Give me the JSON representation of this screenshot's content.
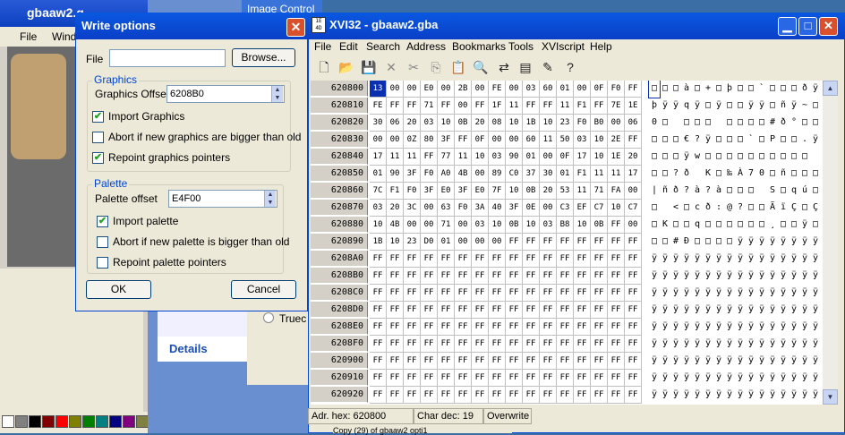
{
  "bg_app": {
    "title": "gbaaw2.g",
    "menu": [
      "File",
      "Windo"
    ]
  },
  "image_control": {
    "title": "Image Control",
    "details_tab": "Details",
    "truec_label": "Truec"
  },
  "dialog": {
    "title": "Write options",
    "file_label": "File",
    "file_value": "",
    "browse_button": "Browse...",
    "graphics_group": "Graphics",
    "graphics_offset_label": "Graphics Offset",
    "graphics_offset_value": "6208B0",
    "import_graphics": {
      "label": "Import Graphics",
      "checked": true
    },
    "abort_graphics": {
      "label": "Abort if new graphics are bigger than old",
      "checked": false
    },
    "repoint_graphics": {
      "label": "Repoint graphics pointers",
      "checked": true
    },
    "palette_group": "Palette",
    "palette_offset_label": "Palette offset",
    "palette_offset_value": "E4F00",
    "import_palette": {
      "label": "Import palette",
      "checked": true
    },
    "abort_palette": {
      "label": "Abort if new palette is bigger than old",
      "checked": false
    },
    "repoint_palette": {
      "label": "Repoint palette pointers",
      "checked": false
    },
    "ok_button": "OK",
    "cancel_button": "Cancel"
  },
  "xvi": {
    "title": "XVI32 - gbaaw2.gba",
    "menu": [
      "File",
      "Edit",
      "Search",
      "Address",
      "Bookmarks",
      "Tools",
      "XVIscript",
      "Help"
    ],
    "toolbar_icons": [
      "new-icon",
      "open-icon",
      "save-icon",
      "delete-icon",
      "cut-icon",
      "copy-icon",
      "paste-icon",
      "find-icon",
      "replace-icon",
      "properties-icon",
      "edit-icon",
      "help-icon"
    ],
    "rows": [
      {
        "addr": "620800",
        "hex": [
          "13",
          "00",
          "00",
          "E0",
          "00",
          "2B",
          "00",
          "FE",
          "00",
          "03",
          "60",
          "01",
          "00",
          "0F",
          "F0",
          "FF"
        ],
        "ascii": "□□□à□+□þ□□`□□□ðÿ"
      },
      {
        "addr": "620810",
        "hex": [
          "FE",
          "FF",
          "FF",
          "71",
          "FF",
          "00",
          "FF",
          "1F",
          "11",
          "FF",
          "FF",
          "11",
          "F1",
          "FF",
          "7E",
          "1E"
        ],
        "ascii": "þÿÿqÿ□ÿ□□ÿÿ□ñÿ~□"
      },
      {
        "addr": "620820",
        "hex": [
          "30",
          "06",
          "20",
          "03",
          "10",
          "0B",
          "20",
          "08",
          "10",
          "1B",
          "10",
          "23",
          "F0",
          "B0",
          "00",
          "06"
        ],
        "ascii": "0□ □□□ □□□□#ð°□□"
      },
      {
        "addr": "620830",
        "hex": [
          "00",
          "00",
          "0Z",
          "80",
          "3F",
          "FF",
          "0F",
          "00",
          "00",
          "60",
          "11",
          "50",
          "03",
          "10",
          "2E",
          "FF"
        ],
        "ascii": "□□□€?ÿ□□□`□P□□.ÿ"
      },
      {
        "addr": "620840",
        "hex": [
          "17",
          "11",
          "11",
          "FF",
          "77",
          "11",
          "10",
          "03",
          "90",
          "01",
          "00",
          "0F",
          "17",
          "10",
          "1E",
          "20"
        ],
        "ascii": "□□□ÿw□□□□□□□□□□ "
      },
      {
        "addr": "620850",
        "hex": [
          "01",
          "90",
          "3F",
          "F0",
          "A0",
          "4B",
          "00",
          "89",
          "C0",
          "37",
          "30",
          "01",
          "F1",
          "11",
          "11",
          "17"
        ],
        "ascii": "□□?ð K□‰À70□ñ□□□"
      },
      {
        "addr": "620860",
        "hex": [
          "7C",
          "F1",
          "F0",
          "3F",
          "E0",
          "3F",
          "E0",
          "7F",
          "10",
          "0B",
          "20",
          "53",
          "11",
          "71",
          "FA",
          "00"
        ],
        "ascii": "|ñð?à?à□□□ S□qú□"
      },
      {
        "addr": "620870",
        "hex": [
          "03",
          "20",
          "3C",
          "00",
          "63",
          "F0",
          "3A",
          "40",
          "3F",
          "0E",
          "00",
          "C3",
          "EF",
          "C7",
          "10",
          "C7"
        ],
        "ascii": "□ <□cð:@?□□ÃïÇ□Ç"
      },
      {
        "addr": "620880",
        "hex": [
          "10",
          "4B",
          "00",
          "00",
          "71",
          "00",
          "03",
          "10",
          "0B",
          "10",
          "03",
          "B8",
          "10",
          "0B",
          "FF",
          "00"
        ],
        "ascii": "□K□□q□□□□□□¸□□ÿ□"
      },
      {
        "addr": "620890",
        "hex": [
          "1B",
          "10",
          "23",
          "D0",
          "01",
          "00",
          "00",
          "00",
          "FF",
          "FF",
          "FF",
          "FF",
          "FF",
          "FF",
          "FF",
          "FF"
        ],
        "ascii": "□□#Ð□□□□ÿÿÿÿÿÿÿÿ"
      },
      {
        "addr": "6208A0",
        "hex": [
          "FF",
          "FF",
          "FF",
          "FF",
          "FF",
          "FF",
          "FF",
          "FF",
          "FF",
          "FF",
          "FF",
          "FF",
          "FF",
          "FF",
          "FF",
          "FF"
        ],
        "ascii": "ÿÿÿÿÿÿÿÿÿÿÿÿÿÿÿÿ"
      },
      {
        "addr": "6208B0",
        "hex": [
          "FF",
          "FF",
          "FF",
          "FF",
          "FF",
          "FF",
          "FF",
          "FF",
          "FF",
          "FF",
          "FF",
          "FF",
          "FF",
          "FF",
          "FF",
          "FF"
        ],
        "ascii": "ÿÿÿÿÿÿÿÿÿÿÿÿÿÿÿÿ"
      },
      {
        "addr": "6208C0",
        "hex": [
          "FF",
          "FF",
          "FF",
          "FF",
          "FF",
          "FF",
          "FF",
          "FF",
          "FF",
          "FF",
          "FF",
          "FF",
          "FF",
          "FF",
          "FF",
          "FF"
        ],
        "ascii": "ÿÿÿÿÿÿÿÿÿÿÿÿÿÿÿÿ"
      },
      {
        "addr": "6208D0",
        "hex": [
          "FF",
          "FF",
          "FF",
          "FF",
          "FF",
          "FF",
          "FF",
          "FF",
          "FF",
          "FF",
          "FF",
          "FF",
          "FF",
          "FF",
          "FF",
          "FF"
        ],
        "ascii": "ÿÿÿÿÿÿÿÿÿÿÿÿÿÿÿÿ"
      },
      {
        "addr": "6208E0",
        "hex": [
          "FF",
          "FF",
          "FF",
          "FF",
          "FF",
          "FF",
          "FF",
          "FF",
          "FF",
          "FF",
          "FF",
          "FF",
          "FF",
          "FF",
          "FF",
          "FF"
        ],
        "ascii": "ÿÿÿÿÿÿÿÿÿÿÿÿÿÿÿÿ"
      },
      {
        "addr": "6208F0",
        "hex": [
          "FF",
          "FF",
          "FF",
          "FF",
          "FF",
          "FF",
          "FF",
          "FF",
          "FF",
          "FF",
          "FF",
          "FF",
          "FF",
          "FF",
          "FF",
          "FF"
        ],
        "ascii": "ÿÿÿÿÿÿÿÿÿÿÿÿÿÿÿÿ"
      },
      {
        "addr": "620900",
        "hex": [
          "FF",
          "FF",
          "FF",
          "FF",
          "FF",
          "FF",
          "FF",
          "FF",
          "FF",
          "FF",
          "FF",
          "FF",
          "FF",
          "FF",
          "FF",
          "FF"
        ],
        "ascii": "ÿÿÿÿÿÿÿÿÿÿÿÿÿÿÿÿ"
      },
      {
        "addr": "620910",
        "hex": [
          "FF",
          "FF",
          "FF",
          "FF",
          "FF",
          "FF",
          "FF",
          "FF",
          "FF",
          "FF",
          "FF",
          "FF",
          "FF",
          "FF",
          "FF",
          "FF"
        ],
        "ascii": "ÿÿÿÿÿÿÿÿÿÿÿÿÿÿÿÿ"
      },
      {
        "addr": "620920",
        "hex": [
          "FF",
          "FF",
          "FF",
          "FF",
          "FF",
          "FF",
          "FF",
          "FF",
          "FF",
          "FF",
          "FF",
          "FF",
          "FF",
          "FF",
          "FF",
          "FF"
        ],
        "ascii": "ÿÿÿÿÿÿÿÿÿÿÿÿÿÿÿÿ"
      }
    ],
    "status": {
      "address": "Adr. hex: 620800",
      "char": "Char dec: 19",
      "mode": "Overwrite"
    }
  },
  "palette_colors": [
    "#ffffff",
    "#808080",
    "#000000",
    "#800000",
    "#ff0000",
    "#808000",
    "#008000",
    "#008080",
    "#000080",
    "#800080",
    "#808040"
  ],
  "taskbar_fragment": "Copy (29) of gbaaw2   opti1"
}
